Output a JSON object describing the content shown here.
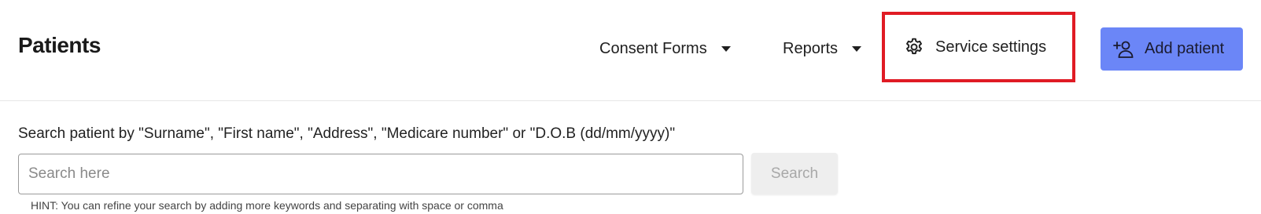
{
  "header": {
    "title": "Patients",
    "nav": {
      "consent_forms": "Consent Forms",
      "reports": "Reports",
      "service_settings": "Service settings"
    },
    "add_patient_label": "Add patient"
  },
  "search": {
    "label": "Search patient by \"Surname\", \"First name\", \"Address\", \"Medicare number\" or \"D.O.B (dd/mm/yyyy)\"",
    "placeholder": "Search here",
    "value": "",
    "button_label": "Search",
    "hint": "HINT: You can refine your search by adding more keywords and separating with space or comma"
  },
  "icons": {
    "dropdown": "caret-down-icon",
    "settings": "gear-icon",
    "add_patient": "person-add-icon"
  },
  "colors": {
    "primary_button": "#6b86f7",
    "highlight_border": "#e01b24",
    "disabled_button": "#eeeeee"
  }
}
